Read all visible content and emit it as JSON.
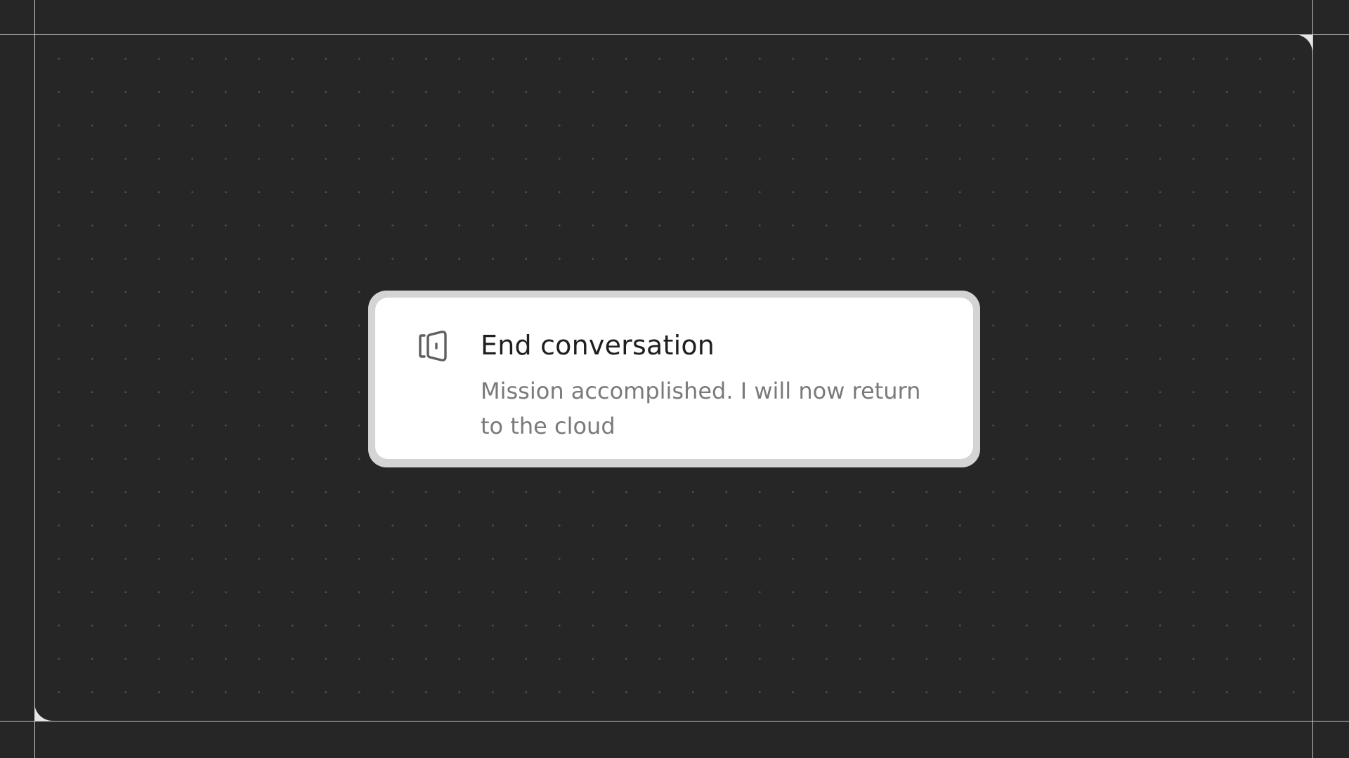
{
  "colors": {
    "background": "#262626",
    "card_border": "#d4d4d4",
    "card_background": "#ffffff",
    "title_color": "#1f1f1f",
    "description_color": "#7a7a7a",
    "guide_line": "#d8d8d8",
    "grid_dot": "#4f4f4f"
  },
  "card": {
    "icon": "door-exit-icon",
    "title": "End conversation",
    "description": "Mission accomplished. I will now return to the cloud"
  }
}
